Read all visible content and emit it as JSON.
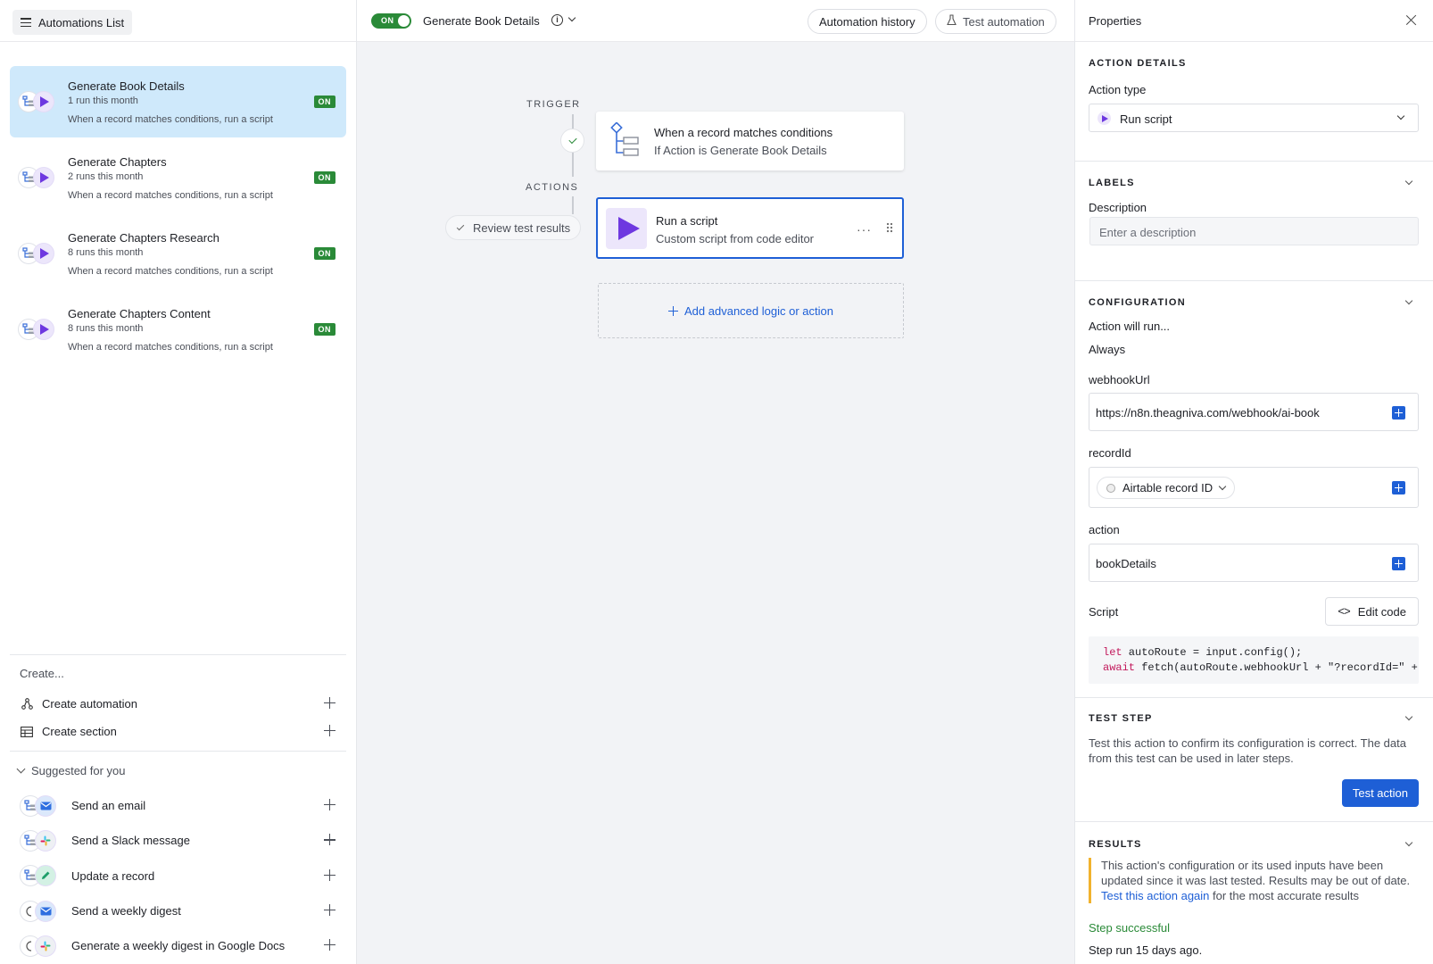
{
  "sidebar": {
    "list_button": "Automations List",
    "automations": [
      {
        "name": "Generate Book Details",
        "runs": "1 run this month",
        "desc": "When a record matches conditions, run a script",
        "status": "ON",
        "active": true
      },
      {
        "name": "Generate Chapters",
        "runs": "2 runs this month",
        "desc": "When a record matches conditions, run a script",
        "status": "ON",
        "active": false
      },
      {
        "name": "Generate Chapters Research",
        "runs": "8 runs this month",
        "desc": "When a record matches conditions, run a script",
        "status": "ON",
        "active": false
      },
      {
        "name": "Generate Chapters Content",
        "runs": "8 runs this month",
        "desc": "When a record matches conditions, run a script",
        "status": "ON",
        "active": false
      }
    ],
    "create": {
      "title": "Create...",
      "items": [
        {
          "label": "Create automation",
          "icon": "automation-icon"
        },
        {
          "label": "Create section",
          "icon": "section-icon"
        }
      ]
    },
    "suggested": {
      "title": "Suggested for you",
      "items": [
        {
          "label": "Send an email",
          "icon": "email-icon"
        },
        {
          "label": "Send a Slack message",
          "icon": "slack-icon"
        },
        {
          "label": "Update a record",
          "icon": "pencil-icon"
        },
        {
          "label": "Send a weekly digest",
          "icon": "email-icon"
        },
        {
          "label": "Generate a weekly digest in Google Docs",
          "icon": "slack-icon"
        }
      ]
    }
  },
  "header": {
    "toggle_label": "ON",
    "flow_title": "Generate Book Details",
    "history_button": "Automation history",
    "test_button": "Test automation"
  },
  "canvas": {
    "trigger_label": "TRIGGER",
    "actions_label": "ACTIONS",
    "review_pill": "Review test results",
    "trigger_card": {
      "title": "When a record matches conditions",
      "subtitle": "If Action is Generate Book Details"
    },
    "action_card": {
      "title": "Run a script",
      "subtitle": "Custom script from code editor",
      "menu": "···"
    },
    "add_button": "Add advanced logic or action"
  },
  "properties": {
    "title": "Properties",
    "action_details": {
      "heading": "ACTION DETAILS",
      "action_type_label": "Action type",
      "action_type_value": "Run script"
    },
    "labels": {
      "heading": "LABELS",
      "description_label": "Description",
      "description_placeholder": "Enter a description"
    },
    "configuration": {
      "heading": "CONFIGURATION",
      "will_run_label": "Action will run...",
      "will_run_value": "Always",
      "webhook_label": "webhookUrl",
      "webhook_value": "https://n8n.theagniva.com/webhook/ai-book",
      "record_label": "recordId",
      "record_value": "Airtable record ID",
      "action_label": "action",
      "action_value": "bookDetails",
      "script_label": "Script",
      "edit_code": "Edit code",
      "code_line1_kw": "let",
      "code_line1": " autoRoute = input.config();",
      "code_line2_kw": "await",
      "code_line2": " fetch(autoRoute.webhookUrl + \"?recordId=\" +"
    },
    "test_step": {
      "heading": "TEST STEP",
      "text": "Test this action to confirm its configuration is correct. The data from this test can be used in later steps.",
      "button": "Test action"
    },
    "results": {
      "heading": "RESULTS",
      "warning_pre": "This action's configuration or its used inputs have been updated since it was last tested. Results may be out of date. ",
      "warning_link": "Test this action again",
      "warning_post": " for the most accurate results",
      "status": "Step successful",
      "status_color": "#2a8a38",
      "run_time": "Step run 15 days ago."
    }
  },
  "colors": {
    "accent": "#1e5fd6",
    "on_green": "#2a8a38",
    "active_item": "#cfe9fb",
    "script_purple": "#6e38e0"
  }
}
